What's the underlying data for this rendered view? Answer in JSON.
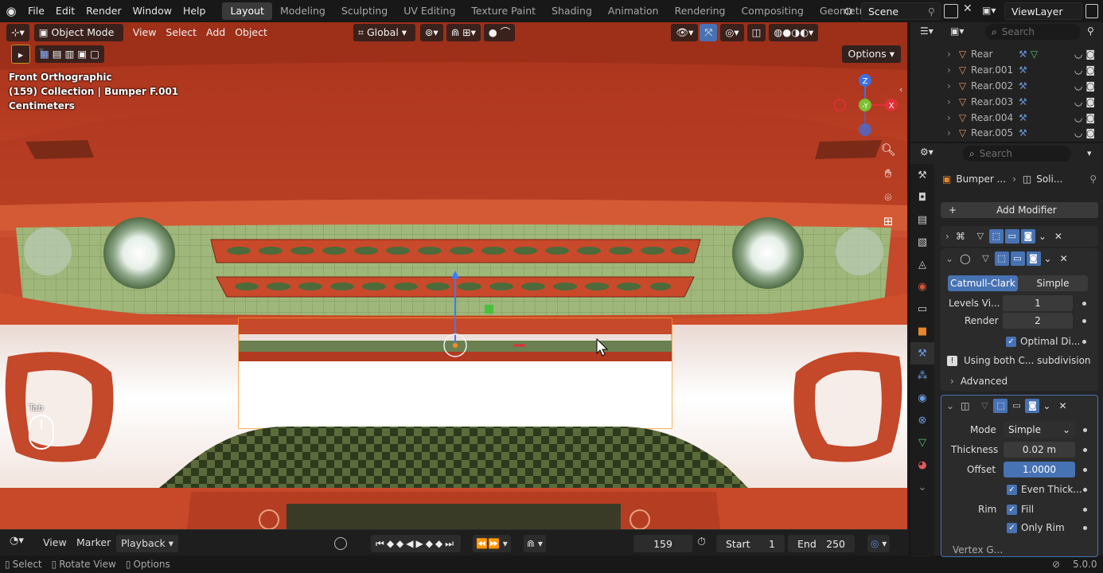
{
  "menu": [
    "File",
    "Edit",
    "Render",
    "Window",
    "Help"
  ],
  "workspaces": [
    {
      "label": "Layout",
      "active": true
    },
    {
      "label": "Modeling",
      "active": false
    },
    {
      "label": "Sculpting",
      "active": false
    },
    {
      "label": "UV Editing",
      "active": false
    },
    {
      "label": "Texture Paint",
      "active": false
    },
    {
      "label": "Shading",
      "active": false
    },
    {
      "label": "Animation",
      "active": false
    },
    {
      "label": "Rendering",
      "active": false
    },
    {
      "label": "Compositing",
      "active": false
    },
    {
      "label": "Geometry Nodes",
      "active": false
    }
  ],
  "scene": "Scene",
  "view_layer": "ViewLayer",
  "viewport": {
    "mode": "Object Mode",
    "menus": [
      "View",
      "Select",
      "Add",
      "Object"
    ],
    "transform_orientation": "Global",
    "options": "Options",
    "info_line1": "Front Orthographic",
    "info_line2": "(159) Collection | Bumper F.001",
    "info_line3": "Centimeters",
    "key_hint": "Tab",
    "gizmo": {
      "z": "Z",
      "y": "-Y",
      "x": "X"
    }
  },
  "outliner": {
    "search_placeholder": "Search",
    "rows": [
      "Rear",
      "Rear.001",
      "Rear.002",
      "Rear.003",
      "Rear.004",
      "Rear.005"
    ]
  },
  "properties": {
    "search_placeholder": "Search",
    "breadcrumb_object": "Bumper ...",
    "breadcrumb_modifier": "Soli...",
    "add_modifier": "Add Modifier",
    "subsurf": {
      "type_catmull": "Catmull-Clark",
      "type_simple": "Simple",
      "levels_viewport_label": "Levels Vi...",
      "levels_viewport": "1",
      "render_label": "Render",
      "render": "2",
      "optimal_display": "Optimal Di...",
      "info": "Using both C... subdivision",
      "advanced": "Advanced"
    },
    "solidify": {
      "mode_label": "Mode",
      "mode": "Simple",
      "thickness_label": "Thickness",
      "thickness": "0.02 m",
      "offset_label": "Offset",
      "offset": "1.0000",
      "even_thickness": "Even Thick...",
      "rim_label": "Rim",
      "fill": "Fill",
      "only_rim": "Only Rim",
      "next_label": "Vertex G..."
    }
  },
  "timeline": {
    "menus": [
      "View",
      "Marker",
      "Playback"
    ],
    "current_frame": "159",
    "start_label": "Start",
    "start": "1",
    "end_label": "End",
    "end": "250"
  },
  "statusbar": {
    "select": "Select",
    "rotate": "Rotate View",
    "options": "Options",
    "version": "5.0.0"
  },
  "colors": {
    "accent": "#4772b3",
    "car_body": "#c5492a",
    "active_tab": "#3a3a3a"
  }
}
